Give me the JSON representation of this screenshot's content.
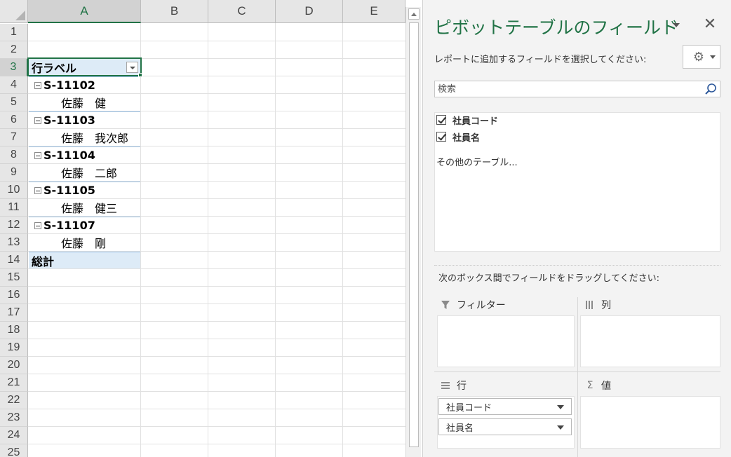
{
  "sheet": {
    "columns": [
      "A",
      "B",
      "C",
      "D",
      "E"
    ],
    "rows": [
      "1",
      "2",
      "3",
      "4",
      "5",
      "6",
      "7",
      "8",
      "9",
      "10",
      "11",
      "12",
      "13",
      "14",
      "15",
      "16",
      "17",
      "18",
      "19",
      "20",
      "21",
      "22",
      "23",
      "24",
      "25"
    ],
    "pivot_header": "行ラベル",
    "cells": {
      "r4": "S-11102",
      "r5": "佐藤　健",
      "r6": "S-11103",
      "r7": "佐藤　我次郎",
      "r8": "S-11104",
      "r9": "佐藤　二郎",
      "r10": "S-11105",
      "r11": "佐藤　健三",
      "r12": "S-11107",
      "r13": "佐藤　剛",
      "r14": "総計"
    }
  },
  "pane": {
    "title": "ピボットテーブルのフィールド",
    "subtitle": "レポートに追加するフィールドを選択してください:",
    "search_placeholder": "検索",
    "fields": [
      {
        "label": "社員コード",
        "checked": true
      },
      {
        "label": "社員名",
        "checked": true
      }
    ],
    "more_tables": "その他のテーブル...",
    "drag_instruction": "次のボックス間でフィールドをドラッグしてください:",
    "areas": {
      "filter": "フィルター",
      "columns": "列",
      "rows": "行",
      "values": "値"
    },
    "row_chips": [
      "社員コード",
      "社員名"
    ]
  },
  "colors": {
    "accent": "#217346",
    "pivot_header_bg": "#ddebf7",
    "pivot_border": "#9bc2e6"
  },
  "icons": {
    "close": "close-icon",
    "gear": "gear-icon",
    "search": "search-icon",
    "filter": "filter-icon",
    "columns": "columns-icon",
    "rows": "rows-icon",
    "values": "sigma-icon"
  }
}
